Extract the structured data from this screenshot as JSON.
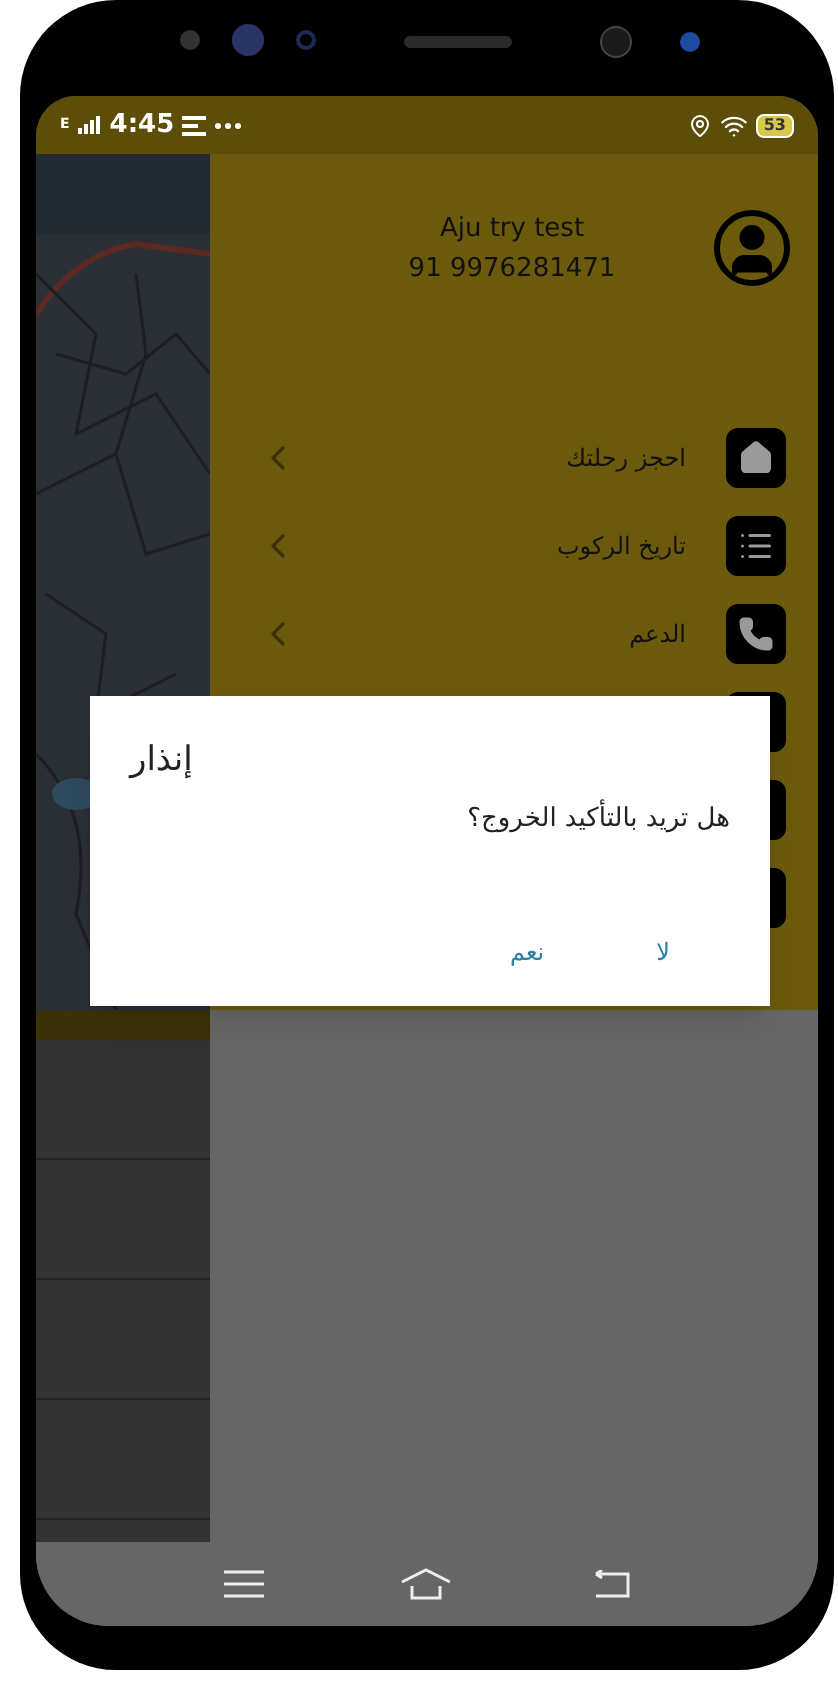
{
  "status_bar": {
    "network": "E",
    "time": "4:45",
    "battery": "53"
  },
  "drawer": {
    "user_name": "Aju try test",
    "phone": "91 9976281471",
    "items": [
      {
        "kind": "home",
        "label": "احجز رحلتك"
      },
      {
        "kind": "list",
        "label": "تاريخ الركوب"
      },
      {
        "kind": "phone",
        "label": "الدعم"
      }
    ]
  },
  "dialog": {
    "title": "إنذار",
    "message": "هل تريد بالتأكيد الخروج؟",
    "buttons": [
      {
        "label": "لا"
      },
      {
        "label": "نعم"
      }
    ]
  }
}
